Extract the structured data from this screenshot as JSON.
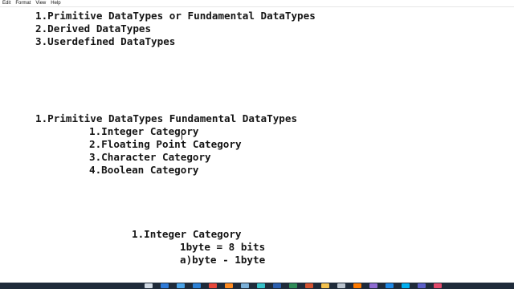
{
  "menu": [
    "Edit",
    "Format",
    "View",
    "Help"
  ],
  "lines": [
    "1.Primitive DataTypes or Fundamental DataTypes",
    "2.Derived DataTypes",
    "3.Userdefined DataTypes",
    "1.Primitive DataTypes Fundamental DataTypes",
    "1.Integer Category",
    "2.Floating Point Category",
    "3.Character Category",
    "4.Boolean Category",
    "1.Integer Category",
    "1byte = 8 bits",
    "a)byte - 1byte"
  ],
  "taskbar": {
    "background": "#1f2b3a",
    "icons": [
      {
        "name": "task-view-icon",
        "color": "#cfd8e3"
      },
      {
        "name": "edge-icon",
        "color": "#2f7bd8"
      },
      {
        "name": "store-icon",
        "color": "#4aa3e8"
      },
      {
        "name": "mail-icon",
        "color": "#2e82d6"
      },
      {
        "name": "chrome-icon",
        "color": "#e5473b"
      },
      {
        "name": "firefox-icon",
        "color": "#ff8a1f"
      },
      {
        "name": "notepad-icon",
        "color": "#7bb0d8"
      },
      {
        "name": "terminal-icon",
        "color": "#36c1c9"
      },
      {
        "name": "word-icon",
        "color": "#2b5fae"
      },
      {
        "name": "excel-icon",
        "color": "#2e8b57"
      },
      {
        "name": "powerpoint-icon",
        "color": "#d35230"
      },
      {
        "name": "explorer-icon",
        "color": "#f2c14e"
      },
      {
        "name": "settings-icon",
        "color": "#b9c2cc"
      },
      {
        "name": "vlc-icon",
        "color": "#ff7a00"
      },
      {
        "name": "photos-icon",
        "color": "#8e6bd1"
      },
      {
        "name": "code-icon",
        "color": "#1e88e5"
      },
      {
        "name": "skype-icon",
        "color": "#00aff0"
      },
      {
        "name": "teams-icon",
        "color": "#5b5fc7"
      },
      {
        "name": "music-icon",
        "color": "#e24a6b"
      }
    ]
  }
}
